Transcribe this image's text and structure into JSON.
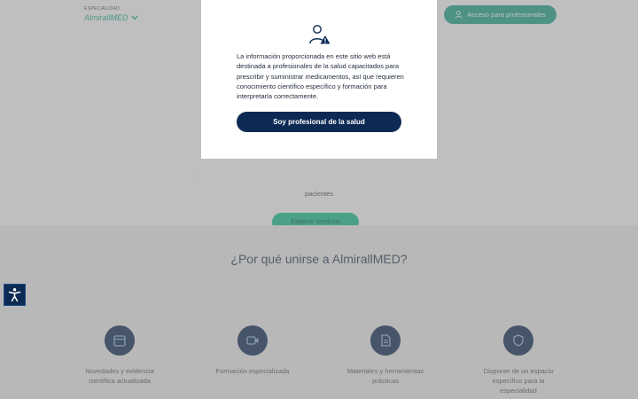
{
  "header": {
    "specialty_label": "ESPECIALIDAD",
    "specialty_value": "AlmirallMED",
    "access_button": "Acceso para profesionales"
  },
  "hero": {
    "text_left": "·",
    "text": "pacientes",
    "cta": "Explorar servicios",
    "slides": 3,
    "active_slide": 2
  },
  "why": {
    "title": "¿Por qué unirse a AlmirallMED?",
    "features": [
      {
        "icon": "calendar-icon",
        "label": "Novedades y evidencia científica actualizada"
      },
      {
        "icon": "video-icon",
        "label": "Formación especializada"
      },
      {
        "icon": "document-icon",
        "label": "Materiales y herramientas prácticas"
      },
      {
        "icon": "shield-icon",
        "label": "Disponer de un espacio específico para la especialidad"
      }
    ]
  },
  "modal": {
    "text": "La información proporcionada en este sitio web está destinada a profesionales de la salud capacitados para prescribir y suministrar medicamentos, así que requieren conocimiento científico específico y formación para interpretarla correctamente.",
    "button": "Soy profesional de la salud"
  },
  "colors": {
    "navy": "#0d2a55",
    "teal": "#1aa58a",
    "green": "#14c38e"
  }
}
